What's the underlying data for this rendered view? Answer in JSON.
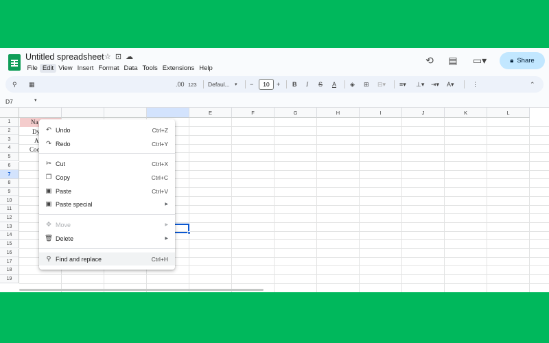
{
  "app": {
    "title": "Untitled spreadsheet",
    "share_label": "Share",
    "menubar": [
      "File",
      "Edit",
      "View",
      "Insert",
      "Format",
      "Data",
      "Tools",
      "Extensions",
      "Help"
    ]
  },
  "toolbar": {
    "number_format_label": ".00",
    "number_format_123": "123",
    "font_label": "Defaul...",
    "font_size": "10"
  },
  "namebox": {
    "value": "D7"
  },
  "grid": {
    "columns": [
      "",
      "",
      "",
      "",
      "E",
      "F",
      "G",
      "H",
      "I",
      "J",
      "K",
      "L"
    ],
    "rows": [
      "1",
      "2",
      "3",
      "4",
      "5",
      "6",
      "7",
      "8",
      "9",
      "10",
      "11",
      "12",
      "13",
      "14",
      "15",
      "16",
      "17",
      "18",
      "19"
    ],
    "selected_row": "7",
    "cells": {
      "a1": "Na",
      "a2": "Dy",
      "a3": "Al",
      "a4": "Coo"
    }
  },
  "edit_menu": {
    "items": [
      {
        "icon": "undo-icon",
        "label": "Undo",
        "shortcut": "Ctrl+Z"
      },
      {
        "icon": "redo-icon",
        "label": "Redo",
        "shortcut": "Ctrl+Y"
      },
      {
        "icon": "cut-icon",
        "label": "Cut",
        "shortcut": "Ctrl+X"
      },
      {
        "icon": "copy-icon",
        "label": "Copy",
        "shortcut": "Ctrl+C"
      },
      {
        "icon": "paste-icon",
        "label": "Paste",
        "shortcut": "Ctrl+V"
      },
      {
        "icon": "paste-special-icon",
        "label": "Paste special",
        "shortcut": ""
      },
      {
        "icon": "move-icon",
        "label": "Move",
        "shortcut": ""
      },
      {
        "icon": "delete-icon",
        "label": "Delete",
        "shortcut": ""
      },
      {
        "icon": "find-replace-icon",
        "label": "Find and replace",
        "shortcut": "Ctrl+H"
      }
    ]
  },
  "colors": {
    "background": "#00b85c",
    "accent": "#0b57d0",
    "share_button": "#c2e7ff",
    "cell_a1_fill": "#f4cccc"
  }
}
